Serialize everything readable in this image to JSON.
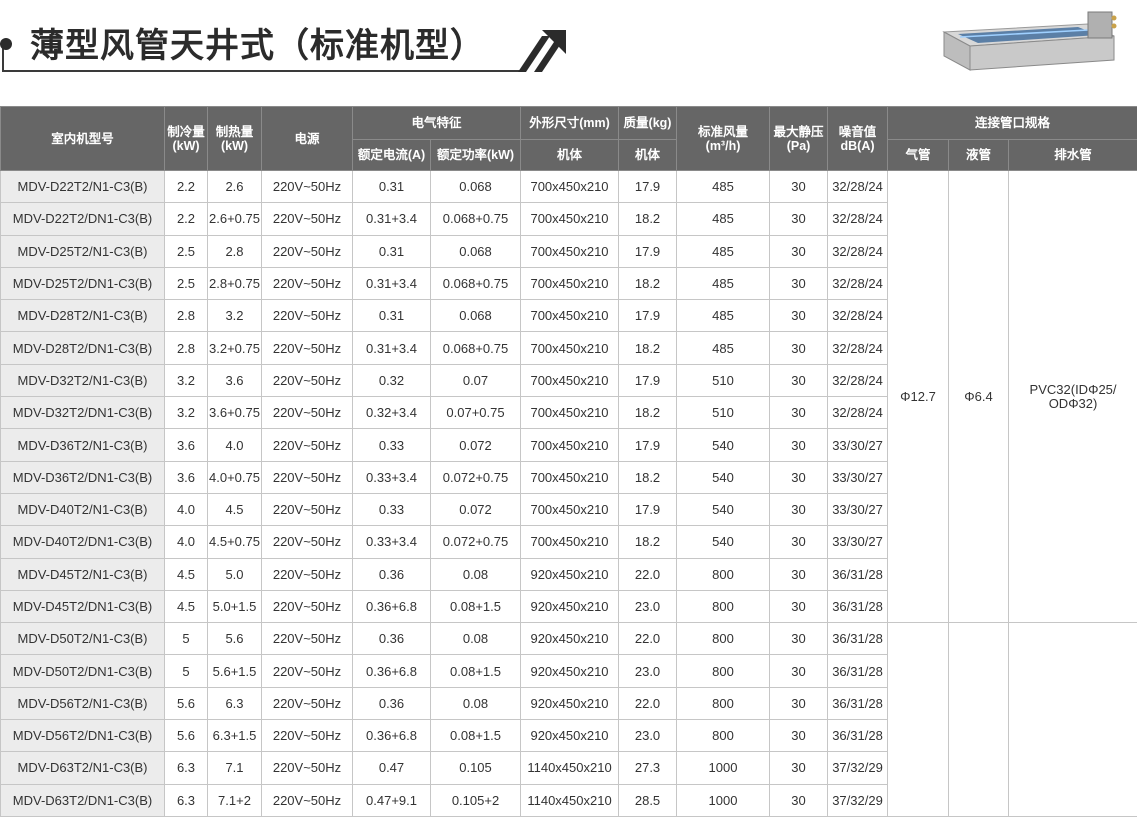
{
  "title": "薄型风管天井式（标准机型）",
  "icons": {
    "product": "ducted-indoor-unit-image",
    "decor": "double-slash-arrow-icon"
  },
  "colors": {
    "header_bg": "#666666",
    "model_col_bg": "#ececec",
    "title": "#2b2b2b"
  },
  "header": {
    "model": "室内机型号",
    "cooling": "制冷量\n(kW)",
    "heating": "制热量\n(kW)",
    "power": "电源",
    "electrical": "电气特征",
    "rated_current": "额定电流(A)",
    "rated_power": "额定功率(kW)",
    "dimensions": "外形尺寸(mm)",
    "dimensions_sub": "机体",
    "weight": "质量(kg)",
    "weight_sub": "机体",
    "airflow": "标准风量\n(m³/h)",
    "static_pressure": "最大静压\n(Pa)",
    "noise": "噪音值\ndB(A)",
    "pipe_spec": "连接管口规格",
    "gas_pipe": "气管",
    "liquid_pipe": "液管",
    "drain_pipe": "排水管"
  },
  "pipe_group1": {
    "gas": "Φ12.7",
    "liquid": "Φ6.4",
    "drain": "PVC32(IDΦ25/\nODΦ32)"
  },
  "rows": [
    [
      "MDV-D22T2/N1-C3(B)",
      "2.2",
      "2.6",
      "220V~50Hz",
      "0.31",
      "0.068",
      "700x450x210",
      "17.9",
      "485",
      "30",
      "32/28/24"
    ],
    [
      "MDV-D22T2/DN1-C3(B)",
      "2.2",
      "2.6+0.75",
      "220V~50Hz",
      "0.31+3.4",
      "0.068+0.75",
      "700x450x210",
      "18.2",
      "485",
      "30",
      "32/28/24"
    ],
    [
      "MDV-D25T2/N1-C3(B)",
      "2.5",
      "2.8",
      "220V~50Hz",
      "0.31",
      "0.068",
      "700x450x210",
      "17.9",
      "485",
      "30",
      "32/28/24"
    ],
    [
      "MDV-D25T2/DN1-C3(B)",
      "2.5",
      "2.8+0.75",
      "220V~50Hz",
      "0.31+3.4",
      "0.068+0.75",
      "700x450x210",
      "18.2",
      "485",
      "30",
      "32/28/24"
    ],
    [
      "MDV-D28T2/N1-C3(B)",
      "2.8",
      "3.2",
      "220V~50Hz",
      "0.31",
      "0.068",
      "700x450x210",
      "17.9",
      "485",
      "30",
      "32/28/24"
    ],
    [
      "MDV-D28T2/DN1-C3(B)",
      "2.8",
      "3.2+0.75",
      "220V~50Hz",
      "0.31+3.4",
      "0.068+0.75",
      "700x450x210",
      "18.2",
      "485",
      "30",
      "32/28/24"
    ],
    [
      "MDV-D32T2/N1-C3(B)",
      "3.2",
      "3.6",
      "220V~50Hz",
      "0.32",
      "0.07",
      "700x450x210",
      "17.9",
      "510",
      "30",
      "32/28/24"
    ],
    [
      "MDV-D32T2/DN1-C3(B)",
      "3.2",
      "3.6+0.75",
      "220V~50Hz",
      "0.32+3.4",
      "0.07+0.75",
      "700x450x210",
      "18.2",
      "510",
      "30",
      "32/28/24"
    ],
    [
      "MDV-D36T2/N1-C3(B)",
      "3.6",
      "4.0",
      "220V~50Hz",
      "0.33",
      "0.072",
      "700x450x210",
      "17.9",
      "540",
      "30",
      "33/30/27"
    ],
    [
      "MDV-D36T2/DN1-C3(B)",
      "3.6",
      "4.0+0.75",
      "220V~50Hz",
      "0.33+3.4",
      "0.072+0.75",
      "700x450x210",
      "18.2",
      "540",
      "30",
      "33/30/27"
    ],
    [
      "MDV-D40T2/N1-C3(B)",
      "4.0",
      "4.5",
      "220V~50Hz",
      "0.33",
      "0.072",
      "700x450x210",
      "17.9",
      "540",
      "30",
      "33/30/27"
    ],
    [
      "MDV-D40T2/DN1-C3(B)",
      "4.0",
      "4.5+0.75",
      "220V~50Hz",
      "0.33+3.4",
      "0.072+0.75",
      "700x450x210",
      "18.2",
      "540",
      "30",
      "33/30/27"
    ],
    [
      "MDV-D45T2/N1-C3(B)",
      "4.5",
      "5.0",
      "220V~50Hz",
      "0.36",
      "0.08",
      "920x450x210",
      "22.0",
      "800",
      "30",
      "36/31/28"
    ],
    [
      "MDV-D45T2/DN1-C3(B)",
      "4.5",
      "5.0+1.5",
      "220V~50Hz",
      "0.36+6.8",
      "0.08+1.5",
      "920x450x210",
      "23.0",
      "800",
      "30",
      "36/31/28"
    ],
    [
      "MDV-D50T2/N1-C3(B)",
      "5",
      "5.6",
      "220V~50Hz",
      "0.36",
      "0.08",
      "920x450x210",
      "22.0",
      "800",
      "30",
      "36/31/28"
    ],
    [
      "MDV-D50T2/DN1-C3(B)",
      "5",
      "5.6+1.5",
      "220V~50Hz",
      "0.36+6.8",
      "0.08+1.5",
      "920x450x210",
      "23.0",
      "800",
      "30",
      "36/31/28"
    ],
    [
      "MDV-D56T2/N1-C3(B)",
      "5.6",
      "6.3",
      "220V~50Hz",
      "0.36",
      "0.08",
      "920x450x210",
      "22.0",
      "800",
      "30",
      "36/31/28"
    ],
    [
      "MDV-D56T2/DN1-C3(B)",
      "5.6",
      "6.3+1.5",
      "220V~50Hz",
      "0.36+6.8",
      "0.08+1.5",
      "920x450x210",
      "23.0",
      "800",
      "30",
      "36/31/28"
    ],
    [
      "MDV-D63T2/N1-C3(B)",
      "6.3",
      "7.1",
      "220V~50Hz",
      "0.47",
      "0.105",
      "1140x450x210",
      "27.3",
      "1000",
      "30",
      "37/32/29"
    ],
    [
      "MDV-D63T2/DN1-C3(B)",
      "6.3",
      "7.1+2",
      "220V~50Hz",
      "0.47+9.1",
      "0.105+2",
      "1140x450x210",
      "28.5",
      "1000",
      "30",
      "37/32/29"
    ]
  ]
}
